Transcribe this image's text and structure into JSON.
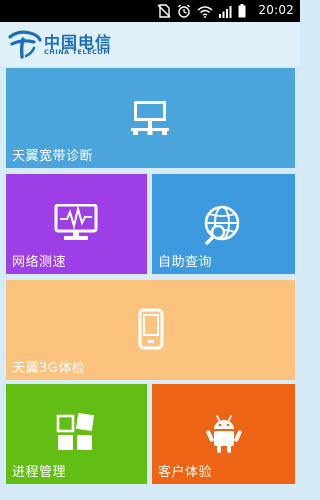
{
  "status_bar": {
    "time": "20:02",
    "icons": [
      "no-sim-icon",
      "alarm-icon",
      "wifi-icon",
      "signal-icon",
      "battery-icon"
    ]
  },
  "header": {
    "brand_cn": "中国电信",
    "brand_en": "CHINA TELECOM",
    "brand_color": "#1b6fb6"
  },
  "tiles": [
    {
      "label": "天翼宽带诊断",
      "icon": "network-monitor-icon",
      "color": "#4aa5dd"
    },
    {
      "label": "网络测速",
      "icon": "speed-monitor-icon",
      "color": "#9d3ee6"
    },
    {
      "label": "自助查询",
      "icon": "globe-search-icon",
      "color": "#3d9adf"
    },
    {
      "label": "天翼3G体检",
      "icon": "phone-icon",
      "color": "#fcc37f"
    },
    {
      "label": "进程管理",
      "icon": "windows-icon",
      "color": "#62bd14"
    },
    {
      "label": "客户体验",
      "icon": "android-icon",
      "color": "#ec6414"
    }
  ]
}
